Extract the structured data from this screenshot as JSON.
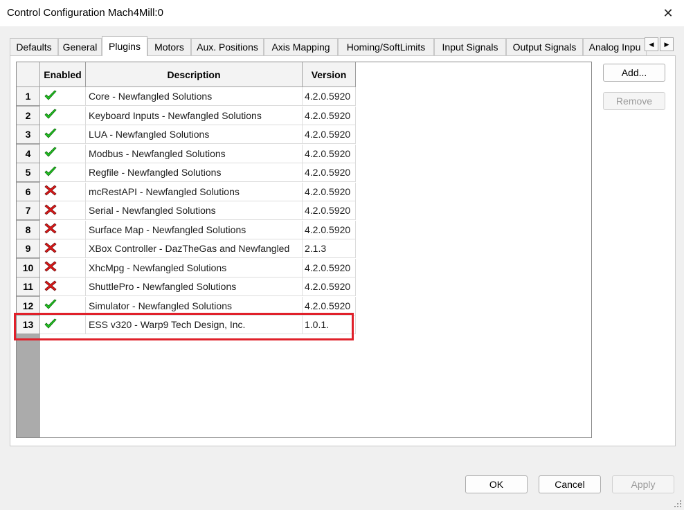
{
  "window": {
    "title": "Control Configuration Mach4Mill:0",
    "close_glyph": "✕"
  },
  "tabs": [
    {
      "label": "Defaults",
      "active": false
    },
    {
      "label": "General",
      "active": false
    },
    {
      "label": "Plugins",
      "active": true
    },
    {
      "label": "Motors",
      "active": false
    },
    {
      "label": "Aux. Positions",
      "active": false
    },
    {
      "label": "Axis Mapping",
      "active": false
    },
    {
      "label": "Homing/SoftLimits",
      "active": false
    },
    {
      "label": "Input Signals",
      "active": false
    },
    {
      "label": "Output Signals",
      "active": false
    },
    {
      "label": "Analog Inpu",
      "active": false
    }
  ],
  "tab_scroll": {
    "left_glyph": "◀",
    "right_glyph": "▶"
  },
  "grid": {
    "headers": {
      "enabled": "Enabled",
      "description": "Description",
      "version": "Version"
    },
    "rows": [
      {
        "num": "1",
        "enabled": true,
        "description": "Core - Newfangled Solutions",
        "version": "4.2.0.5920"
      },
      {
        "num": "2",
        "enabled": true,
        "description": "Keyboard Inputs - Newfangled Solutions",
        "version": "4.2.0.5920"
      },
      {
        "num": "3",
        "enabled": true,
        "description": "LUA - Newfangled Solutions",
        "version": "4.2.0.5920"
      },
      {
        "num": "4",
        "enabled": true,
        "description": "Modbus - Newfangled Solutions",
        "version": "4.2.0.5920"
      },
      {
        "num": "5",
        "enabled": true,
        "description": "Regfile - Newfangled Solutions",
        "version": "4.2.0.5920"
      },
      {
        "num": "6",
        "enabled": false,
        "description": "mcRestAPI - Newfangled Solutions",
        "version": "4.2.0.5920"
      },
      {
        "num": "7",
        "enabled": false,
        "description": "Serial - Newfangled Solutions",
        "version": "4.2.0.5920"
      },
      {
        "num": "8",
        "enabled": false,
        "description": "Surface Map - Newfangled Solutions",
        "version": "4.2.0.5920"
      },
      {
        "num": "9",
        "enabled": false,
        "description": "XBox Controller - DazTheGas and Newfangled",
        "version": "2.1.3"
      },
      {
        "num": "10",
        "enabled": false,
        "description": "XhcMpg - Newfangled Solutions",
        "version": "4.2.0.5920"
      },
      {
        "num": "11",
        "enabled": false,
        "description": "ShuttlePro - Newfangled Solutions",
        "version": "4.2.0.5920"
      },
      {
        "num": "12",
        "enabled": true,
        "description": "Simulator - Newfangled Solutions",
        "version": "4.2.0.5920"
      },
      {
        "num": "13",
        "enabled": true,
        "description": "ESS v320 - Warp9 Tech Design, Inc.",
        "version": "1.0.1."
      }
    ]
  },
  "side_buttons": {
    "add": "Add...",
    "remove": "Remove"
  },
  "footer_buttons": {
    "ok": "OK",
    "cancel": "Cancel",
    "apply": "Apply"
  },
  "colors": {
    "check": "#22c322",
    "cross": "#e01818",
    "highlight": "#e0202a"
  }
}
